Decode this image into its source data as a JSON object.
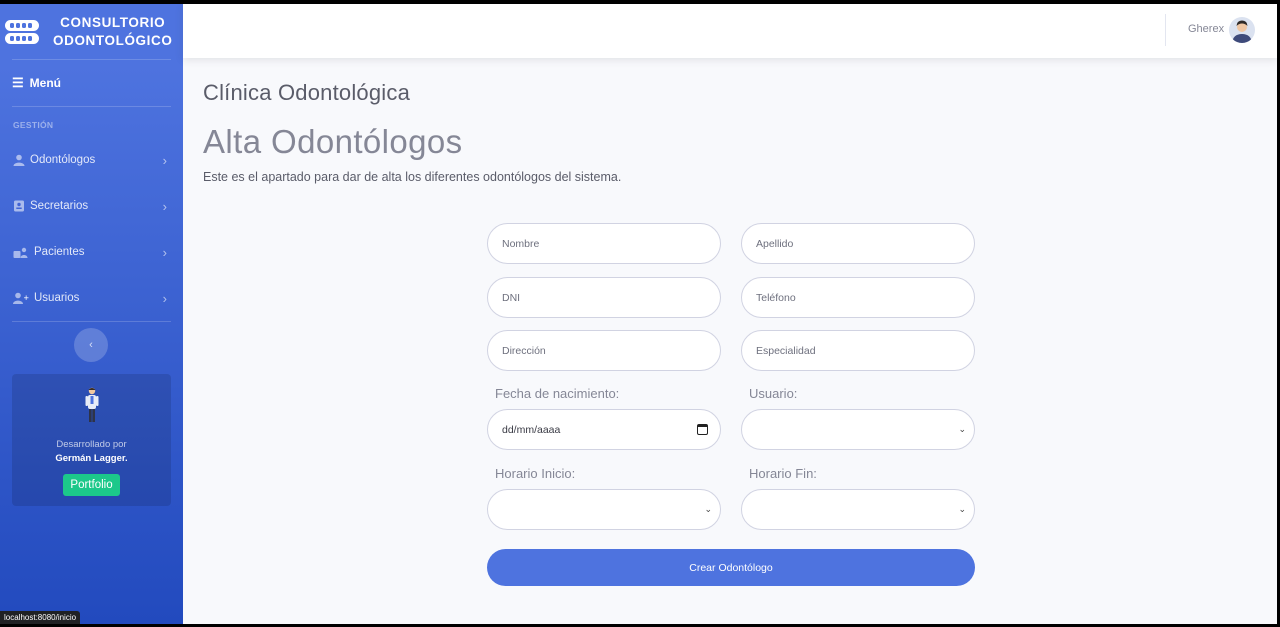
{
  "brand": {
    "line1": "CONSULTORIO",
    "line2": "ODONTOLÓGICO"
  },
  "sidebar": {
    "menu_label": "Menú",
    "section_heading": "GESTIÓN",
    "items": [
      {
        "label": "Odontólogos",
        "icon": "user-icon"
      },
      {
        "label": "Secretarios",
        "icon": "id-card-icon"
      },
      {
        "label": "Pacientes",
        "icon": "users-icon"
      },
      {
        "label": "Usuarios",
        "icon": "user-plus-icon"
      }
    ],
    "card": {
      "text": "Desarrollado por",
      "author": "Germán Lagger.",
      "button_label": "Portfolio"
    }
  },
  "topbar": {
    "username": "Gherex"
  },
  "page": {
    "clinic_title": "Clínica Odontológica",
    "title": "Alta Odontólogos",
    "subtitle": "Este es el apartado para dar de alta los diferentes odontólogos del sistema."
  },
  "form": {
    "nombre_placeholder": "Nombre",
    "apellido_placeholder": "Apellido",
    "dni_placeholder": "DNI",
    "telefono_placeholder": "Teléfono",
    "direccion_placeholder": "Dirección",
    "especialidad_placeholder": "Especialidad",
    "fecha_label": "Fecha de nacimiento:",
    "fecha_placeholder": "dd/mm/aaaa",
    "usuario_label": "Usuario:",
    "horario_inicio_label": "Horario Inicio:",
    "horario_fin_label": "Horario Fin:",
    "submit_label": "Crear Odontólogo"
  },
  "status_bar": {
    "url": "localhost:8080/inicio"
  },
  "colors": {
    "primary": "#4e73df",
    "sidebar_dark": "#224abe",
    "success": "#1cc88a",
    "background": "#f8f9fc"
  }
}
